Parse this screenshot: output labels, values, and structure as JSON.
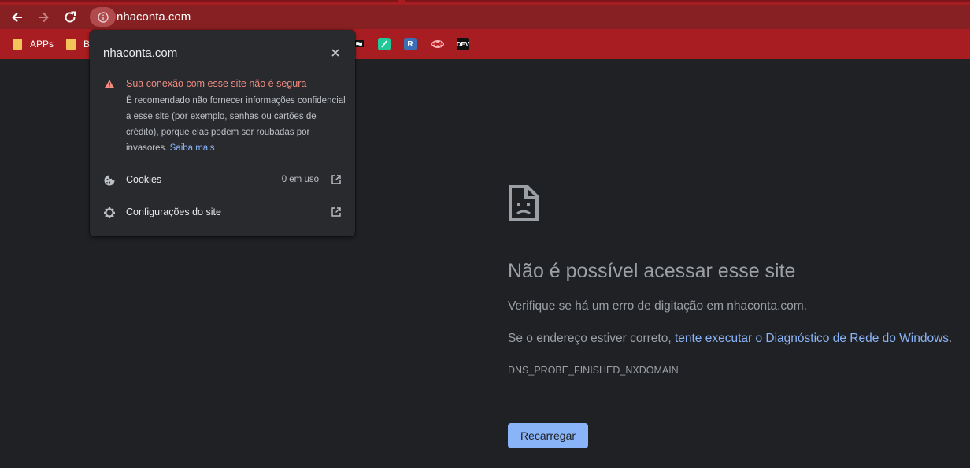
{
  "browser": {
    "url": "nhaconta.com",
    "bookmarks": [
      {
        "label": "APPs",
        "type": "folder"
      },
      {
        "label": "B",
        "type": "folder"
      }
    ],
    "bookmark_icons": [
      "flag-icon",
      "sublime-icon",
      "r-icon",
      "bookmark-icon",
      "dev-icon"
    ],
    "dev_label": "DEV",
    "r_label": "R",
    "colors": {
      "toolbar": "#862022",
      "bookmarks_bar": "#a71d21"
    }
  },
  "popup": {
    "domain": "nhaconta.com",
    "warning_title": "Sua conexão com esse site não é segura",
    "warning_text": "É recomendado não fornecer informações confidencial a esse site (por exemplo, senhas ou cartões de crédito), porque elas podem ser roubadas por invasores.",
    "learn_more": "Saiba mais",
    "cookies_label": "Cookies",
    "cookies_value": "0 em uso",
    "site_settings_label": "Configurações do site"
  },
  "error": {
    "title": "Não é possível acessar esse site",
    "line1": "Verifique se há um erro de digitação em nhaconta.com.",
    "line2_prefix": "Se o endereço estiver correto, ",
    "line2_link": "tente executar o Diagnóstico de Rede do Windows",
    "line2_suffix": ".",
    "code": "DNS_PROBE_FINISHED_NXDOMAIN",
    "reload_label": "Recarregar"
  }
}
